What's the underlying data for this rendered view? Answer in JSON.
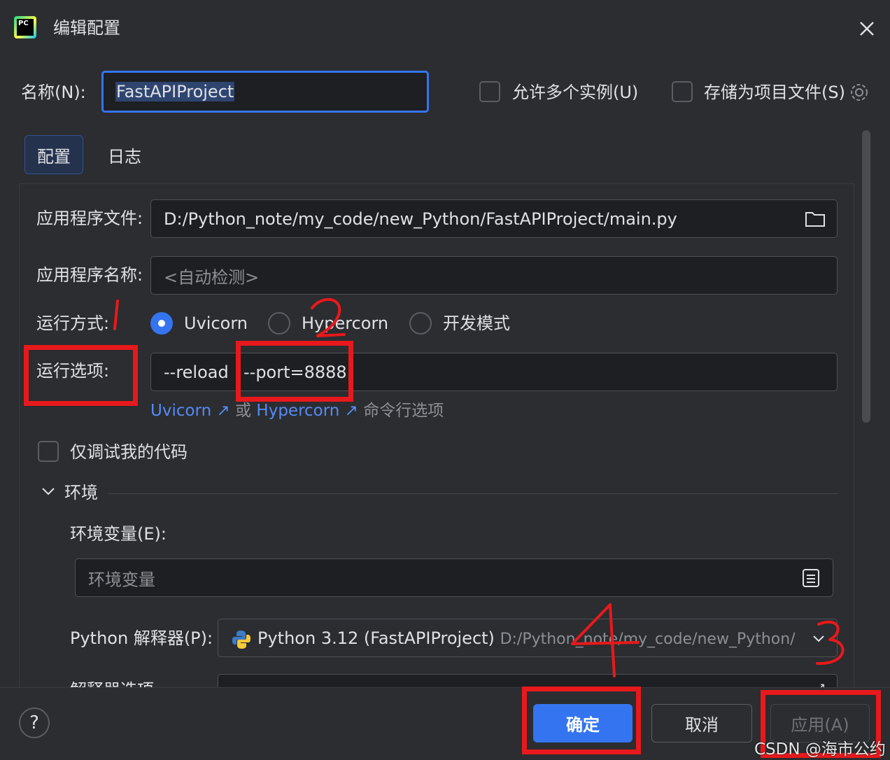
{
  "window": {
    "title": "编辑配置",
    "logo_text": "PC"
  },
  "name_row": {
    "label": "名称(N):",
    "value": "FastAPIProject",
    "allow_multiple": "允许多个实例(U)",
    "store_as_file": "存储为项目文件(S)"
  },
  "tabs": [
    {
      "label": "配置",
      "active": true
    },
    {
      "label": "日志",
      "active": false
    }
  ],
  "config": {
    "app_file_label": "应用程序文件:",
    "app_file_value": "D:/Python_note/my_code/new_Python/FastAPIProject/main.py",
    "app_name_label": "应用程序名称:",
    "app_name_placeholder": "<自动检测>",
    "run_mode_label": "运行方式:",
    "run_modes": [
      {
        "label": "Uvicorn",
        "selected": true
      },
      {
        "label": "Hypercorn",
        "selected": false
      },
      {
        "label": "开发模式",
        "selected": false
      }
    ],
    "run_options_label": "运行选项:",
    "run_options_reload": "--reload",
    "run_options_port": "--port=8888",
    "help_link_uvicorn": "Uvicorn",
    "help_or": "或",
    "help_link_hypercorn": "Hypercorn",
    "help_suffix": "命令行选项",
    "debug_my_code": "仅调试我的代码"
  },
  "env": {
    "section_title": "环境",
    "env_vars_label": "环境变量(E):",
    "env_vars_placeholder": "环境变量",
    "interpreter_label": "Python 解释器(P):",
    "interpreter_name": "Python 3.12 (FastAPIProject)",
    "interpreter_path": "D:/Python_note/my_code/new_Python/FastAPIProject",
    "interpreter_options_label": "解释器选项"
  },
  "footer": {
    "help": "?",
    "ok": "确定",
    "cancel": "取消",
    "apply": "应用(A)"
  },
  "annotations": {
    "n1": "1",
    "n2": "2",
    "n3": "3",
    "n4": "4"
  },
  "watermark": "CSDN @海市公约",
  "colors": {
    "accent": "#3574f0",
    "annotation_red": "#e8191c",
    "background": "#2b2d30"
  }
}
